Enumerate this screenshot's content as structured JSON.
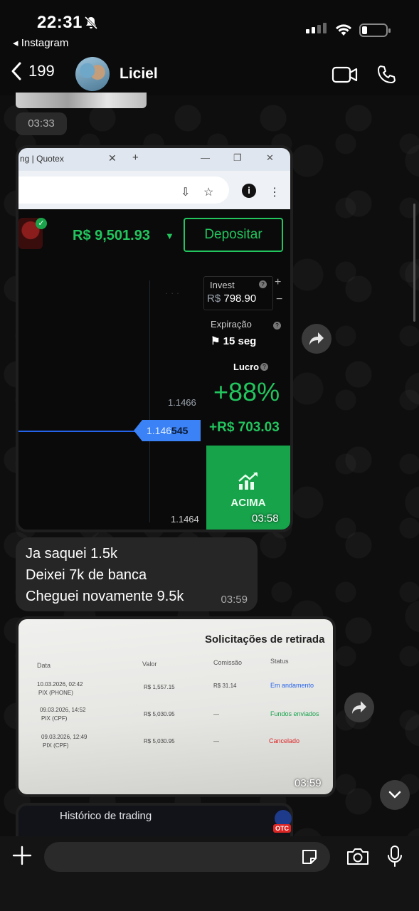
{
  "status_bar": {
    "time": "22:31",
    "back_app": "◂ Instagram"
  },
  "header": {
    "back_count": "199",
    "contact_name": "Liciel"
  },
  "messages": {
    "first_time": "03:33",
    "screenshot1": {
      "tab_title": "ng | Quotex",
      "balance": "R$ 9,501.93",
      "deposit_label": "Depositar",
      "invest_label": "Invest",
      "invest_currency": "R$",
      "invest_value": "798.90",
      "expiry_label": "Expiração",
      "expiry_value": "15 seg",
      "profit_label": "Lucro",
      "profit_pct": "+88%",
      "profit_amount": "+R$ 703.03",
      "price_top": "1.1466",
      "price_current_prefix": "1.146",
      "price_current_suffix": "545",
      "price_bottom": "1.1464",
      "up_label": "ACIMA",
      "time": "03:58"
    },
    "text_message": {
      "lines": [
        "Ja saquei 1.5k",
        "Deixei 7k de banca",
        "Cheguei novamente 9.5k"
      ],
      "time": "03:59"
    },
    "screenshot2": {
      "title": "Solicitações de retirada",
      "headers": [
        "Data",
        "Valor",
        "Comissão",
        "Status"
      ],
      "rows": [
        {
          "date": "10.03.2026, 02:42",
          "method": "PIX (PHONE)",
          "value": "R$ 1,557.15",
          "commission": "R$ 31.14",
          "status": "Em andamento",
          "status_color": "#2563eb"
        },
        {
          "date": "09.03.2026, 14:52",
          "method": "PIX (CPF)",
          "value": "R$ 5,030.95",
          "commission": "—",
          "status": "Fundos enviados",
          "status_color": "#16a34a"
        },
        {
          "date": "09.03.2026, 12:49",
          "method": "PIX (CPF)",
          "value": "R$ 5,030.95",
          "commission": "—",
          "status": "Cancelado",
          "status_color": "#dc2626"
        }
      ],
      "time": "03:59"
    },
    "screenshot3": {
      "title": "Histórico de trading",
      "badge": "OTC"
    }
  },
  "composer": {
    "placeholder": ""
  }
}
